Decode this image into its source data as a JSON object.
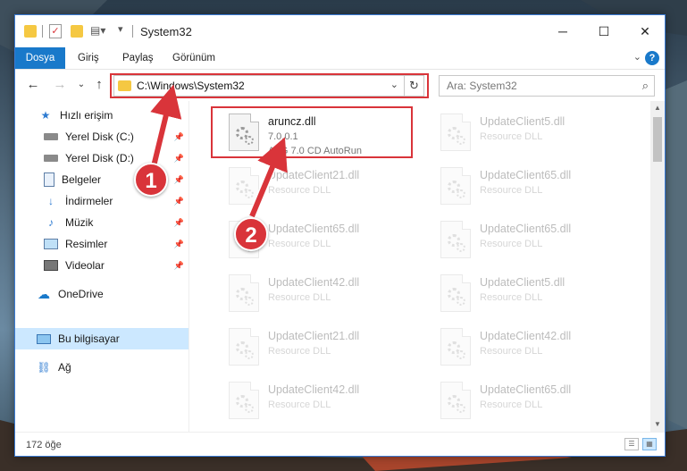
{
  "window": {
    "title": "System32"
  },
  "ribbon": {
    "tabs": [
      {
        "label": "Dosya",
        "active": true
      },
      {
        "label": "Giriş"
      },
      {
        "label": "Paylaş"
      },
      {
        "label": "Görünüm"
      }
    ]
  },
  "navigation": {
    "address_path": "C:\\Windows\\System32",
    "search_placeholder": "Ara: System32"
  },
  "sidebar": {
    "items": [
      {
        "label": "Hızlı erişim",
        "icon": "star-icon"
      },
      {
        "label": "Yerel Disk (C:)",
        "icon": "drive-icon",
        "pinned": true
      },
      {
        "label": "Yerel Disk (D:)",
        "icon": "drive-icon",
        "pinned": true
      },
      {
        "label": "Belgeler",
        "icon": "documents-icon",
        "pinned": true
      },
      {
        "label": "İndirmeler",
        "icon": "download-icon",
        "pinned": true
      },
      {
        "label": "Müzik",
        "icon": "music-icon",
        "pinned": true
      },
      {
        "label": "Resimler",
        "icon": "pictures-icon",
        "pinned": true
      },
      {
        "label": "Videolar",
        "icon": "videos-icon",
        "pinned": true
      },
      {
        "label": "OneDrive",
        "icon": "cloud-icon"
      },
      {
        "label": "Bu bilgisayar",
        "icon": "computer-icon",
        "selected": true
      },
      {
        "label": "Ağ",
        "icon": "network-icon"
      }
    ]
  },
  "files": {
    "highlighted": {
      "name": "aruncz.dll",
      "version": "7.0.0.1",
      "description": "AVG 7.0 CD AutoRun"
    },
    "left_column": [
      {
        "name": "UpdateClient21.dll",
        "type": "Resource DLL"
      },
      {
        "name": "UpdateClient65.dll",
        "type": "Resource DLL"
      },
      {
        "name": "UpdateClient42.dll",
        "type": "Resource DLL"
      },
      {
        "name": "UpdateClient21.dll",
        "type": "Resource DLL"
      },
      {
        "name": "UpdateClient42.dll",
        "type": "Resource DLL"
      }
    ],
    "right_column": [
      {
        "name": "UpdateClient5.dll",
        "type": "Resource DLL"
      },
      {
        "name": "UpdateClient65.dll",
        "type": "Resource DLL"
      },
      {
        "name": "UpdateClient65.dll",
        "type": "Resource DLL"
      },
      {
        "name": "UpdateClient5.dll",
        "type": "Resource DLL"
      },
      {
        "name": "UpdateClient42.dll",
        "type": "Resource DLL"
      },
      {
        "name": "UpdateClient65.dll",
        "type": "Resource DLL"
      }
    ]
  },
  "status": {
    "item_count": "172 öğe"
  },
  "annotations": {
    "marker1": "1",
    "marker2": "2",
    "color": "#d9343a"
  }
}
